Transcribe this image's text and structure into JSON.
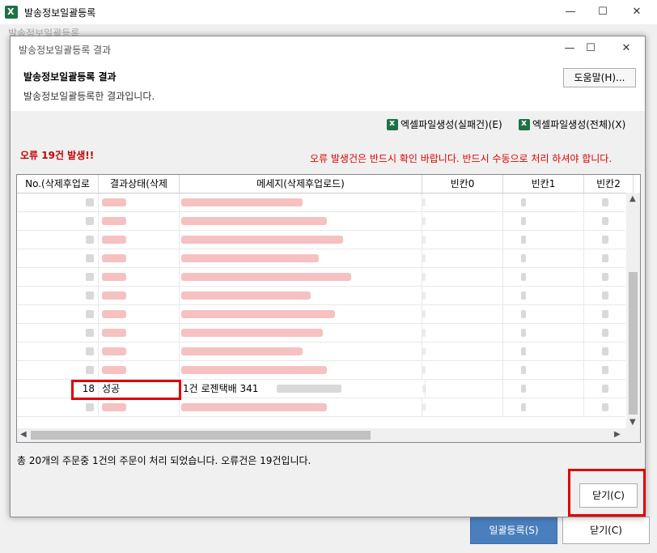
{
  "parent": {
    "title": "발송정보일괄등록",
    "ghost_label": "발송정보일괄등록",
    "register_button": "일괄등록(S)",
    "close_button": "닫기(C)"
  },
  "dialog": {
    "title": "발송정보일괄등록 결과",
    "header_title": "발송정보일괄등록 결과",
    "header_subtitle": "발송정보일괄등록한 결과입니다.",
    "help_button": "도움말(H)...",
    "excel_failed": "엑셀파일생성(실패건)(E)",
    "excel_all": "엑셀파일생성(전체)(X)",
    "error_count": "오류 19건 발생!!",
    "error_notice": "오류 발생건은 반드시 확인 바랍니다. 반드시 수동으로 처리 하셔야 합니다.",
    "status_text": "총 20개의 주문중 1건의 주문이 처리 되었습니다. 오류건은 19건입니다.",
    "close_button": "닫기(C)"
  },
  "grid": {
    "columns": [
      "No.(삭제후업로",
      "결과상태(삭제",
      "메세지(삭제후업로드)",
      "빈칸0",
      "빈칸1",
      "빈칸2"
    ],
    "visible_row": {
      "no": "18",
      "status": "성공",
      "message": "1건 로젠택배 341"
    }
  },
  "colors": {
    "error": "#e00000",
    "primary_button": "#4a7fbe",
    "highlight": "#e00000"
  },
  "icons": [
    "excel-icon",
    "minimize-icon",
    "maximize-icon",
    "close-icon"
  ]
}
